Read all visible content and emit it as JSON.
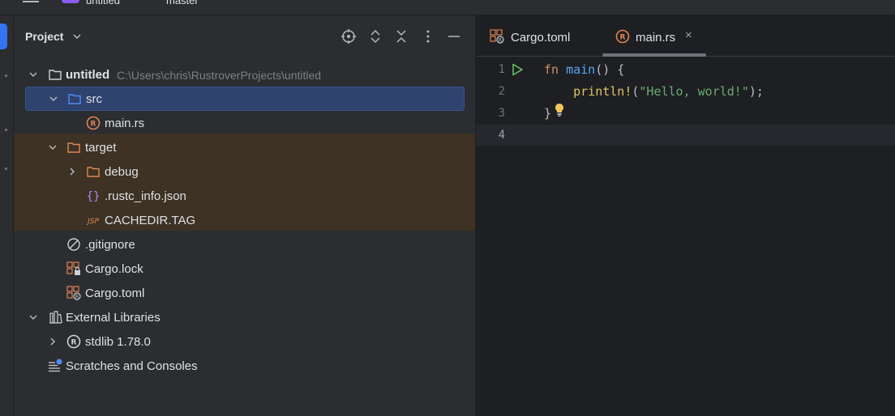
{
  "topbar": {
    "project_name": "untitled",
    "branch": "master"
  },
  "project_panel": {
    "title": "Project",
    "tree": [
      {
        "label": "untitled",
        "path": "C:\\Users\\chris\\RustroverProjects\\untitled",
        "icon": "folder-icon",
        "expanded": true
      },
      {
        "label": "src",
        "icon": "source-folder-icon",
        "expanded": true,
        "selected": true
      },
      {
        "label": "main.rs",
        "icon": "rust-file-icon"
      },
      {
        "label": "target",
        "icon": "folder-icon",
        "expanded": true,
        "excluded": true
      },
      {
        "label": "debug",
        "icon": "folder-icon",
        "expanded": false,
        "excluded": true
      },
      {
        "label": ".rustc_info.json",
        "icon": "json-file-icon",
        "excluded": true
      },
      {
        "label": "CACHEDIR.TAG",
        "icon": "jsp-file-icon",
        "excluded": true
      },
      {
        "label": ".gitignore",
        "icon": "ignore-file-icon"
      },
      {
        "label": "Cargo.lock",
        "icon": "cargo-lock-icon"
      },
      {
        "label": "Cargo.toml",
        "icon": "cargo-toml-icon"
      },
      {
        "label": "External Libraries",
        "icon": "library-icon",
        "expanded": true
      },
      {
        "label": "stdlib 1.78.0",
        "icon": "rust-icon",
        "expanded": false
      },
      {
        "label": "Scratches and Consoles",
        "icon": "scratches-icon"
      }
    ]
  },
  "editor": {
    "tabs": [
      {
        "label": "Cargo.toml",
        "icon": "cargo-toml-icon",
        "active": false
      },
      {
        "label": "main.rs",
        "icon": "rust-file-icon",
        "active": true,
        "close": "×"
      }
    ],
    "line_numbers": [
      "1",
      "2",
      "3",
      "4"
    ],
    "code": {
      "l1_kw": "fn",
      "l1_fn": "main",
      "l1_rest": "() {",
      "l2_macro": "println!",
      "l2_open": "(",
      "l2_str": "\"Hello, world!\"",
      "l2_close": ");",
      "l3": "}"
    },
    "current_line": "4"
  },
  "colors": {
    "accent": "#3574f0",
    "selection": "#2e436e",
    "excluded_bg": "#3d3223",
    "run": "#5fb865",
    "bulb": "#f2c55c",
    "rust_icon": "#e08355"
  }
}
